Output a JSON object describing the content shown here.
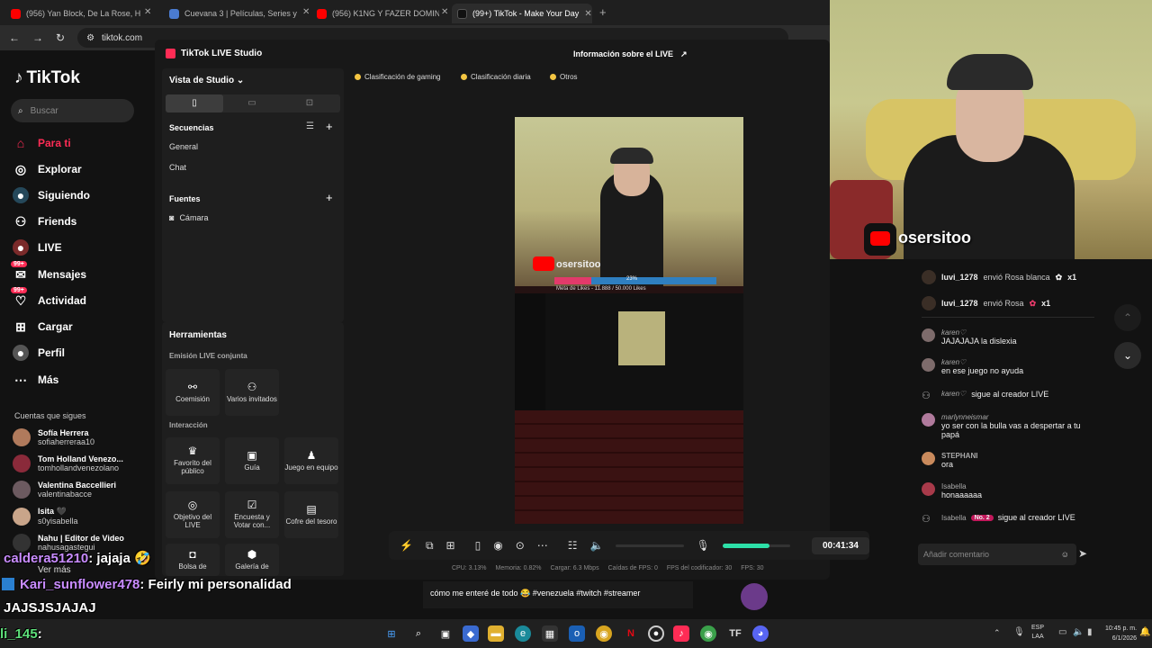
{
  "browser": {
    "tabs": [
      {
        "label": "(956) Yan Block, De La Rose, Ha",
        "color": "#ff0000"
      },
      {
        "label": "Cuevana 3 | Películas, Series y A",
        "color": "#4a7bd0"
      },
      {
        "label": "(956) K1NG Y FAZER DOMINAN",
        "color": "#ff0000"
      },
      {
        "label": "(99+) TikTok - Make Your Day",
        "color": "#fe2c55"
      }
    ],
    "new_tab": "+",
    "url": "tiktok.com"
  },
  "sidebar": {
    "logo": "TikTok",
    "search_placeholder": "Buscar",
    "items": [
      {
        "label": "Para ti",
        "icon": "home-icon"
      },
      {
        "label": "Explorar",
        "icon": "compass-icon"
      },
      {
        "label": "Siguiendo",
        "icon": "following-icon"
      },
      {
        "label": "Friends",
        "icon": "friends-icon"
      },
      {
        "label": "LIVE",
        "icon": "live-icon"
      },
      {
        "label": "Mensajes",
        "icon": "message-icon",
        "badge": "99+"
      },
      {
        "label": "Actividad",
        "icon": "activity-icon",
        "badge": "99+"
      },
      {
        "label": "Cargar",
        "icon": "upload-icon"
      },
      {
        "label": "Perfil",
        "icon": "profile-icon"
      },
      {
        "label": "Más",
        "icon": "more-icon"
      }
    ],
    "following_title": "Cuentas que sigues",
    "following": [
      {
        "name": "Sofía Herrera",
        "user": "sofiaherreraa10",
        "color": "#b07a5c"
      },
      {
        "name": "Tom Holland Venezo...",
        "user": "tomhollandvenezolano",
        "color": "#8a2a3a"
      },
      {
        "name": "Valentina Baccellieri",
        "user": "valentinabacce",
        "color": "#6c5a60"
      },
      {
        "name": "Isita 🖤",
        "user": "s0yisabella",
        "color": "#c9a58a"
      },
      {
        "name": "Nahu | Editor de Video",
        "user": "nahusagastegui",
        "color": "#333"
      }
    ],
    "see_more": "Ver más"
  },
  "studio": {
    "title": "TikTok LIVE Studio",
    "header_center": "Información sobre el LIVE",
    "view_label": "Vista de Studio",
    "scenes_title": "Secuencias",
    "scenes": [
      "General",
      "Chat"
    ],
    "sources_title": "Fuentes",
    "sources": [
      "Cámara"
    ],
    "chips": [
      "Clasificación de gaming",
      "Clasificación diaria",
      "Otros"
    ],
    "tools_title": "Herramientas",
    "joint_title": "Emisión LIVE conjunta",
    "joint_tools": [
      "Coemisión",
      "Varios invitados"
    ],
    "interaction_title": "Interacción",
    "interaction_tools": [
      "Favorito del público",
      "Guía",
      "Juego en equipo",
      "Objetivo del LIVE",
      "Encuesta y Votar con...",
      "Cofre del tesoro",
      "Bolsa de",
      "Galería de"
    ],
    "preview_goal": "Meta de Likes - 11.888 / 50.000 Likes",
    "preview_goal_pct": "23%",
    "preview_watermark": "osersitoo",
    "timer": "00:41:34",
    "stats": [
      "CPU: 3.13%",
      "Memoria: 0.82%",
      "Cargar: 6.3 Mbps",
      "Caídas de FPS: 0",
      "FPS del codificador: 30",
      "FPS: 30"
    ]
  },
  "webcam": {
    "watermark": "osersitoo"
  },
  "chat": {
    "gifts": [
      {
        "user": "luvi_1278",
        "text": "envió Rosa blanca",
        "count": "x1"
      },
      {
        "user": "luvi_1278",
        "text": "envió Rosa",
        "count": "x1"
      }
    ],
    "messages": [
      {
        "user": "karen♡",
        "text": "JAJAJAJA la dislexia"
      },
      {
        "user": "karen♡",
        "text": "en ese juego no ayuda"
      },
      {
        "user": "karen♡",
        "text": "sigue al creador LIVE"
      },
      {
        "user": "marlynneismar",
        "text": "yo ser con la bulla vas a despertar a tu papá"
      },
      {
        "user": "STEPHANI",
        "text": "ora"
      },
      {
        "user": "Isabella",
        "text": "honaaaaaa"
      },
      {
        "user": "Isabella",
        "badge": "No. 2",
        "text": "sigue al creador LIVE"
      }
    ],
    "input_placeholder": "Añadir comentario"
  },
  "overlay": {
    "lines": [
      {
        "user": "caldera51210",
        "text": ": jajaja 🤣"
      },
      {
        "user": "Kari_sunflower478",
        "text": ": Feirly mi personalidad"
      },
      {
        "user": "",
        "text": "JAJSJSJAJAJ"
      },
      {
        "user": "li_145",
        "text": ":"
      }
    ],
    "caption": "cómo me enteré de todo 😂 #venezuela #twitch #streamer"
  },
  "taskbar": {
    "lang": "ESP",
    "lang2": "LAA",
    "time": "10:45 p. m.",
    "date": "6/1/2026"
  }
}
